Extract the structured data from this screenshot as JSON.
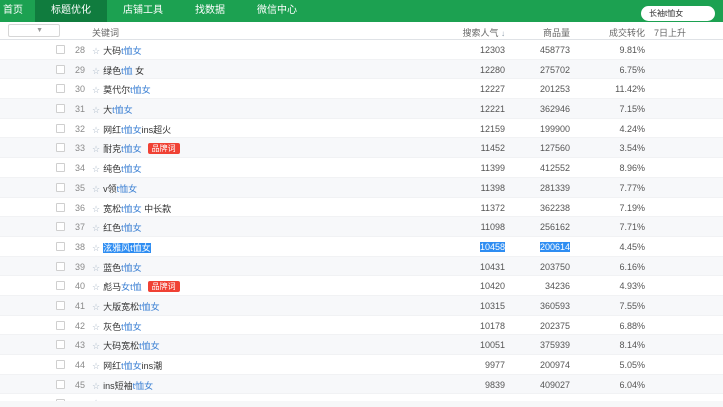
{
  "colors": {
    "navbar_green": "#1ca151",
    "navbar_active_green": "#107c3e",
    "keyword_highlight_blue": "#3e82d4",
    "text_selection_blue": "#2e8df2",
    "brand_badge_red": "#f04134",
    "row_stripe": "#f7f8fa"
  },
  "navbar": {
    "tabs": [
      {
        "label": "首页",
        "active": false
      },
      {
        "label": "标题优化",
        "active": true
      },
      {
        "label": "店铺工具",
        "active": false
      },
      {
        "label": "找数据",
        "active": false
      },
      {
        "label": "微信中心",
        "active": false
      }
    ],
    "search_value": "长袖t恤女"
  },
  "table": {
    "headers": {
      "keyword": "关键词",
      "search_popularity": "搜索人气",
      "sort_icon": "↓",
      "items": "商品量",
      "conversion": "成交转化",
      "rise7d": "7日上升"
    },
    "badge_label": "品牌词",
    "star_icon": "☆",
    "dropdown_caret": "▼",
    "rows": [
      {
        "num": "28",
        "kw_pre": "大码",
        "kw_hl": "t恤女",
        "kw_post": "",
        "badge": false,
        "selected": false,
        "pop": "12303",
        "items": "458773",
        "conv": "9.81%"
      },
      {
        "num": "29",
        "kw_pre": "绿色",
        "kw_hl": "t恤",
        "kw_post": " 女",
        "badge": false,
        "selected": false,
        "pop": "12280",
        "items": "275702",
        "conv": "6.75%"
      },
      {
        "num": "30",
        "kw_pre": "莫代尔",
        "kw_hl": "t恤女",
        "kw_post": "",
        "badge": false,
        "selected": false,
        "pop": "12227",
        "items": "201253",
        "conv": "11.42%"
      },
      {
        "num": "31",
        "kw_pre": "大",
        "kw_hl": "t恤女",
        "kw_post": "",
        "badge": false,
        "selected": false,
        "pop": "12221",
        "items": "362946",
        "conv": "7.15%"
      },
      {
        "num": "32",
        "kw_pre": "网红",
        "kw_hl": "t恤女",
        "kw_post": "ins超火",
        "badge": false,
        "selected": false,
        "pop": "12159",
        "items": "199900",
        "conv": "4.24%"
      },
      {
        "num": "33",
        "kw_pre": "耐克",
        "kw_hl": "t恤女",
        "kw_post": "",
        "badge": true,
        "selected": false,
        "pop": "11452",
        "items": "127560",
        "conv": "3.54%"
      },
      {
        "num": "34",
        "kw_pre": "纯色",
        "kw_hl": "t恤女",
        "kw_post": "",
        "badge": false,
        "selected": false,
        "pop": "11399",
        "items": "412552",
        "conv": "8.96%"
      },
      {
        "num": "35",
        "kw_pre": "v领",
        "kw_hl": "t恤女",
        "kw_post": "",
        "badge": false,
        "selected": false,
        "pop": "11398",
        "items": "281339",
        "conv": "7.77%"
      },
      {
        "num": "36",
        "kw_pre": "宽松",
        "kw_hl": "t恤女",
        "kw_post": " 中长款",
        "badge": false,
        "selected": false,
        "pop": "11372",
        "items": "362238",
        "conv": "7.19%"
      },
      {
        "num": "37",
        "kw_pre": "红色",
        "kw_hl": "t恤女",
        "kw_post": "",
        "badge": false,
        "selected": false,
        "pop": "11098",
        "items": "256162",
        "conv": "7.71%"
      },
      {
        "num": "38",
        "kw_pre": "泫雅风",
        "kw_hl": "t恤女",
        "kw_post": "",
        "badge": false,
        "selected": true,
        "pop": "10458",
        "items": "200614",
        "conv": "4.45%"
      },
      {
        "num": "39",
        "kw_pre": "蓝色",
        "kw_hl": "t恤女",
        "kw_post": "",
        "badge": false,
        "selected": false,
        "pop": "10431",
        "items": "203750",
        "conv": "6.16%"
      },
      {
        "num": "40",
        "kw_pre": "彪马",
        "kw_hl": "女t恤",
        "kw_post": "",
        "badge": true,
        "selected": false,
        "pop": "10420",
        "items": "34236",
        "conv": "4.93%"
      },
      {
        "num": "41",
        "kw_pre": "大版宽松",
        "kw_hl": "t恤女",
        "kw_post": "",
        "badge": false,
        "selected": false,
        "pop": "10315",
        "items": "360593",
        "conv": "7.55%"
      },
      {
        "num": "42",
        "kw_pre": "灰色",
        "kw_hl": "t恤女",
        "kw_post": "",
        "badge": false,
        "selected": false,
        "pop": "10178",
        "items": "202375",
        "conv": "6.88%"
      },
      {
        "num": "43",
        "kw_pre": "大码宽松",
        "kw_hl": "t恤女",
        "kw_post": "",
        "badge": false,
        "selected": false,
        "pop": "10051",
        "items": "375939",
        "conv": "8.14%"
      },
      {
        "num": "44",
        "kw_pre": "网红",
        "kw_hl": "t恤女",
        "kw_post": "ins潮",
        "badge": false,
        "selected": false,
        "pop": "9977",
        "items": "200974",
        "conv": "5.05%"
      },
      {
        "num": "45",
        "kw_pre": "ins短袖",
        "kw_hl": "t恤女",
        "kw_post": "",
        "badge": false,
        "selected": false,
        "pop": "9839",
        "items": "409027",
        "conv": "6.04%"
      },
      {
        "num": "",
        "kw_pre": "",
        "kw_hl": "",
        "kw_post": "",
        "badge": false,
        "selected": false,
        "pop": "",
        "items": "",
        "conv": "",
        "partial": true
      }
    ]
  }
}
